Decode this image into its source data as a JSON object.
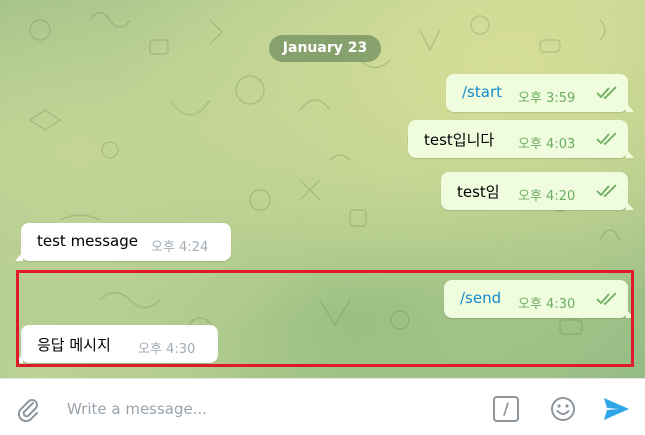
{
  "chat": {
    "date_label": "January 23",
    "messages": [
      {
        "text": "/start",
        "time": "오후 3:59",
        "direction": "outgoing",
        "read": true,
        "is_command": true
      },
      {
        "text": "test입니다",
        "time": "오후 4:03",
        "direction": "outgoing",
        "read": true,
        "is_command": false
      },
      {
        "text": "test임",
        "time": "오후 4:20",
        "direction": "outgoing",
        "read": true,
        "is_command": false
      },
      {
        "text": "test message",
        "time": "오후 4:24",
        "direction": "incoming",
        "read": false,
        "is_command": false
      },
      {
        "text": "/send",
        "time": "오후 4:30",
        "direction": "outgoing",
        "read": true,
        "is_command": true
      },
      {
        "text": "응답 메시지",
        "time": "오후 4:30",
        "direction": "incoming",
        "read": false,
        "is_command": false
      }
    ],
    "highlight_color": "#e0192b"
  },
  "composer": {
    "placeholder": "Write a message...",
    "attach_icon": "paperclip-icon",
    "command_button_label": "/",
    "emoji_icon": "smiley-icon",
    "send_icon": "send-arrow-icon"
  },
  "colors": {
    "outgoing_bubble": "#effdde",
    "incoming_bubble": "#ffffff",
    "command_text": "#168acd",
    "send_accent": "#2ea6e8"
  }
}
